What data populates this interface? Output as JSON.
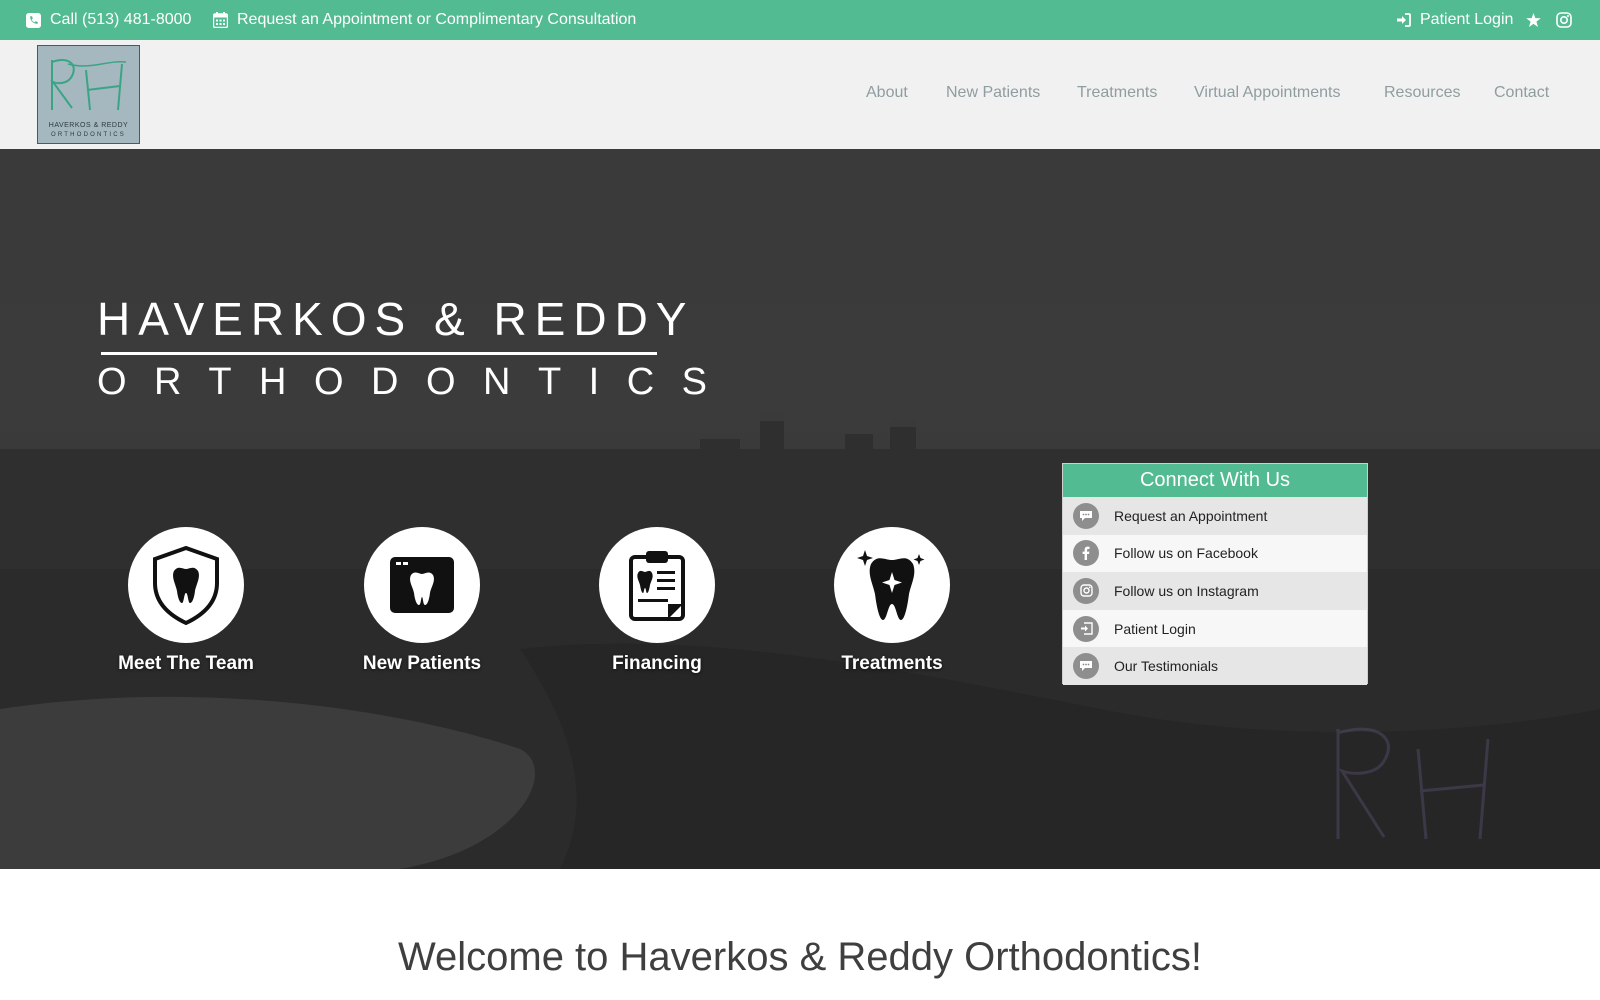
{
  "topbar": {
    "phone": "Call (513) 481-8000",
    "appointment": "Request an Appointment or Complimentary Consultation",
    "login": "Patient Login"
  },
  "logo": {
    "line1": "HAVERKOS & REDDY",
    "line2": "ORTHODONTICS"
  },
  "nav": {
    "items": [
      "About",
      "New Patients",
      "Treatments",
      "Virtual Appointments",
      "Resources",
      "Contact"
    ]
  },
  "hero": {
    "title_line1": "HAVERKOS & REDDY",
    "title_line2": "ORTHODONTICS",
    "features": [
      {
        "label": "Meet The Team",
        "icon": "shield-tooth-icon"
      },
      {
        "label": "New Patients",
        "icon": "browser-tooth-icon"
      },
      {
        "label": "Financing",
        "icon": "clipboard-tooth-icon"
      },
      {
        "label": "Treatments",
        "icon": "sparkle-tooth-icon"
      }
    ]
  },
  "connect": {
    "title": "Connect With Us",
    "items": [
      {
        "label": "Request an Appointment",
        "icon": "chat-icon"
      },
      {
        "label": "Follow us on Facebook",
        "icon": "facebook-icon"
      },
      {
        "label": "Follow us on Instagram",
        "icon": "instagram-icon"
      },
      {
        "label": "Patient Login",
        "icon": "login-icon"
      },
      {
        "label": "Our Testimonials",
        "icon": "chat-icon"
      }
    ]
  },
  "welcome": {
    "heading": "Welcome to Haverkos & Reddy Orthodontics!"
  },
  "colors": {
    "accent": "#52bb92",
    "nav_text": "#8f9da0",
    "header_bg": "#f1f1f1"
  }
}
